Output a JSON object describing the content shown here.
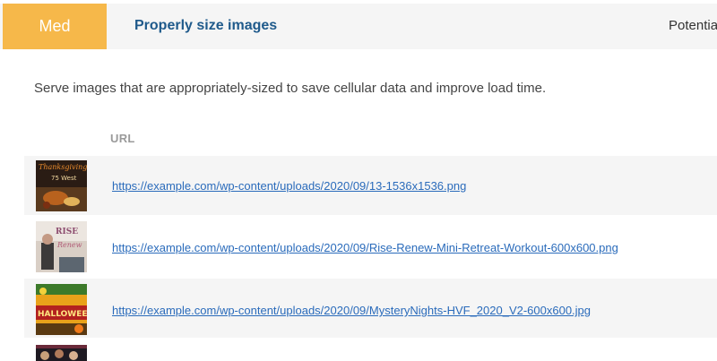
{
  "audit": {
    "severity": "Med",
    "title": "Properly size images",
    "savings_label": "Potentia",
    "description": "Serve images that are appropriately-sized to save cellular data and improve load time."
  },
  "table": {
    "column_header": "URL",
    "rows": [
      {
        "url": "https://example.com/wp-content/uploads/2020/09/13-1536x1536.png",
        "thumb_text": "Thanksgiving at 75 West"
      },
      {
        "url": "https://example.com/wp-content/uploads/2020/09/Rise-Renew-Mini-Retreat-Workout-600x600.png",
        "thumb_text": "RISE Renew"
      },
      {
        "url": "https://example.com/wp-content/uploads/2020/09/MysteryNights-HVF_2020_V2-600x600.jpg",
        "thumb_text": "HALLOWEEN"
      }
    ]
  },
  "colors": {
    "severity_med": "#f6b84a",
    "title": "#1f5a8b",
    "link": "#2a6bbb"
  }
}
